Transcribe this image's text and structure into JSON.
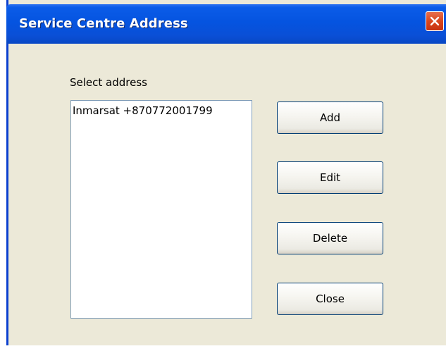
{
  "window": {
    "title": "Service Centre Address",
    "close_icon": "close-icon"
  },
  "address_selector": {
    "label": "Select address",
    "items": [
      "Inmarsat +870772001799"
    ]
  },
  "buttons": {
    "add": "Add",
    "edit": "Edit",
    "delete": "Delete",
    "close": "Close"
  },
  "colors": {
    "titlebar": "#0554E0",
    "dialog_background": "#ECE9D8",
    "close_button": "#D9461E"
  }
}
